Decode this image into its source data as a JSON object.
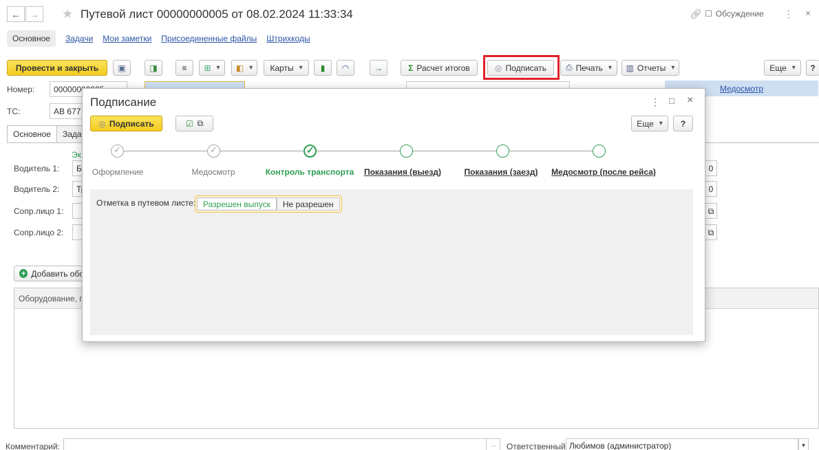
{
  "window": {
    "title": "Путевой лист 00000000005 от 08.02.2024 11:33:34",
    "discussion_label": "Обсуждение"
  },
  "top_tabs": [
    "Основное",
    "Задачи",
    "Мои заметки",
    "Присоединенные файлы",
    "Штрихкоды"
  ],
  "toolbar": {
    "post_close": "Провести и закрыть",
    "maps": "Карты",
    "calc_totals": "Расчет итогов",
    "sign": "Подписать",
    "print": "Печать",
    "reports": "Отчеты",
    "more": "Еще",
    "help": "?"
  },
  "form": {
    "number_label": "Номер:",
    "number_value": "00000000005",
    "ts_label": "ТС:",
    "ts_value": "АВ 677",
    "medosmotr_link": "Медосмотр",
    "tabs": [
      "Основное",
      "Зада"
    ],
    "ek_fragment": "Эк",
    "driver1_label": "Водитель 1:",
    "driver1_value": "Бу",
    "driver2_label": "Водитель 2:",
    "driver2_value": "Тр",
    "escort1_label": "Сопр.лицо 1:",
    "escort2_label": "Сопр.лицо 2:",
    "side_value_1": "0",
    "side_value_2": "0",
    "add_equipment": "Добавить обо",
    "equipment_header": "Оборудование, п",
    "comment_label": "Комментарий:",
    "responsible_label": "Ответственный:",
    "responsible_value": "Любимов (администратор)"
  },
  "modal": {
    "title": "Подписание",
    "sign_button": "Подписать",
    "more": "Еще",
    "help": "?",
    "steps": [
      {
        "label": "Оформление",
        "state": "done"
      },
      {
        "label": "Медосмотр",
        "state": "done"
      },
      {
        "label": "Контроль транспорта",
        "state": "current"
      },
      {
        "label": "Показания (выезд)",
        "state": "future"
      },
      {
        "label": "Показания (заезд)",
        "state": "future"
      },
      {
        "label": "Медосмотр (после рейса)",
        "state": "future"
      }
    ],
    "mark_label": "Отметка в путевом листе:",
    "options": [
      "Разрешен выпуск",
      "Не разрешен"
    ],
    "selected_option": "Разрешен выпуск"
  },
  "colors": {
    "accent_yellow": "#f3cc1f",
    "step_green": "#2e9e52",
    "highlight_red": "#e0202a",
    "link_blue": "#2a55a5"
  }
}
